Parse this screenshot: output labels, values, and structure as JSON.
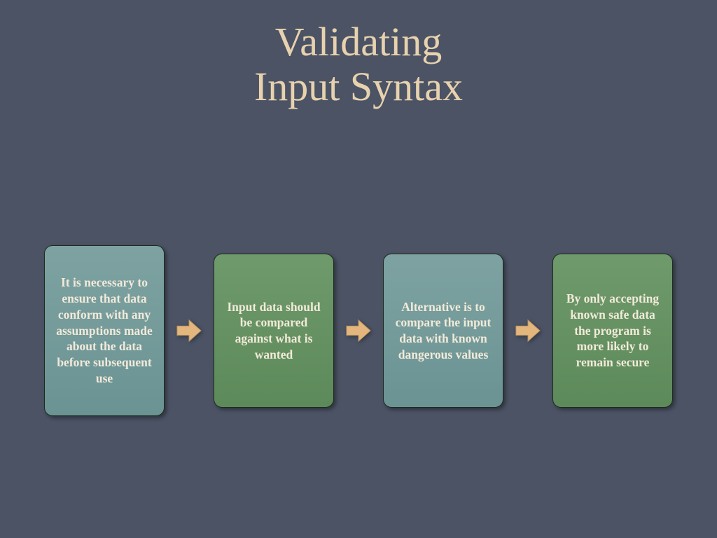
{
  "title_line1": "Validating",
  "title_line2": "Input Syntax",
  "colors": {
    "bg": "#4b5365",
    "title": "#e8d2ae",
    "teal": "#6b9393",
    "green": "#5d8a5a",
    "arrow_fill": "#e2b67d",
    "arrow_stroke": "#b8935f"
  },
  "cards": [
    {
      "text": "It is necessary to ensure that data conform with any assumptions made about the data before subsequent use",
      "color": "teal",
      "tall": true
    },
    {
      "text": "Input data should be compared against what is wanted",
      "color": "green",
      "tall": false
    },
    {
      "text": "Alternative is to compare the input data with known dangerous values",
      "color": "teal",
      "tall": false
    },
    {
      "text": "By only accepting known safe data the program is more likely to remain secure",
      "color": "green",
      "tall": false
    }
  ]
}
